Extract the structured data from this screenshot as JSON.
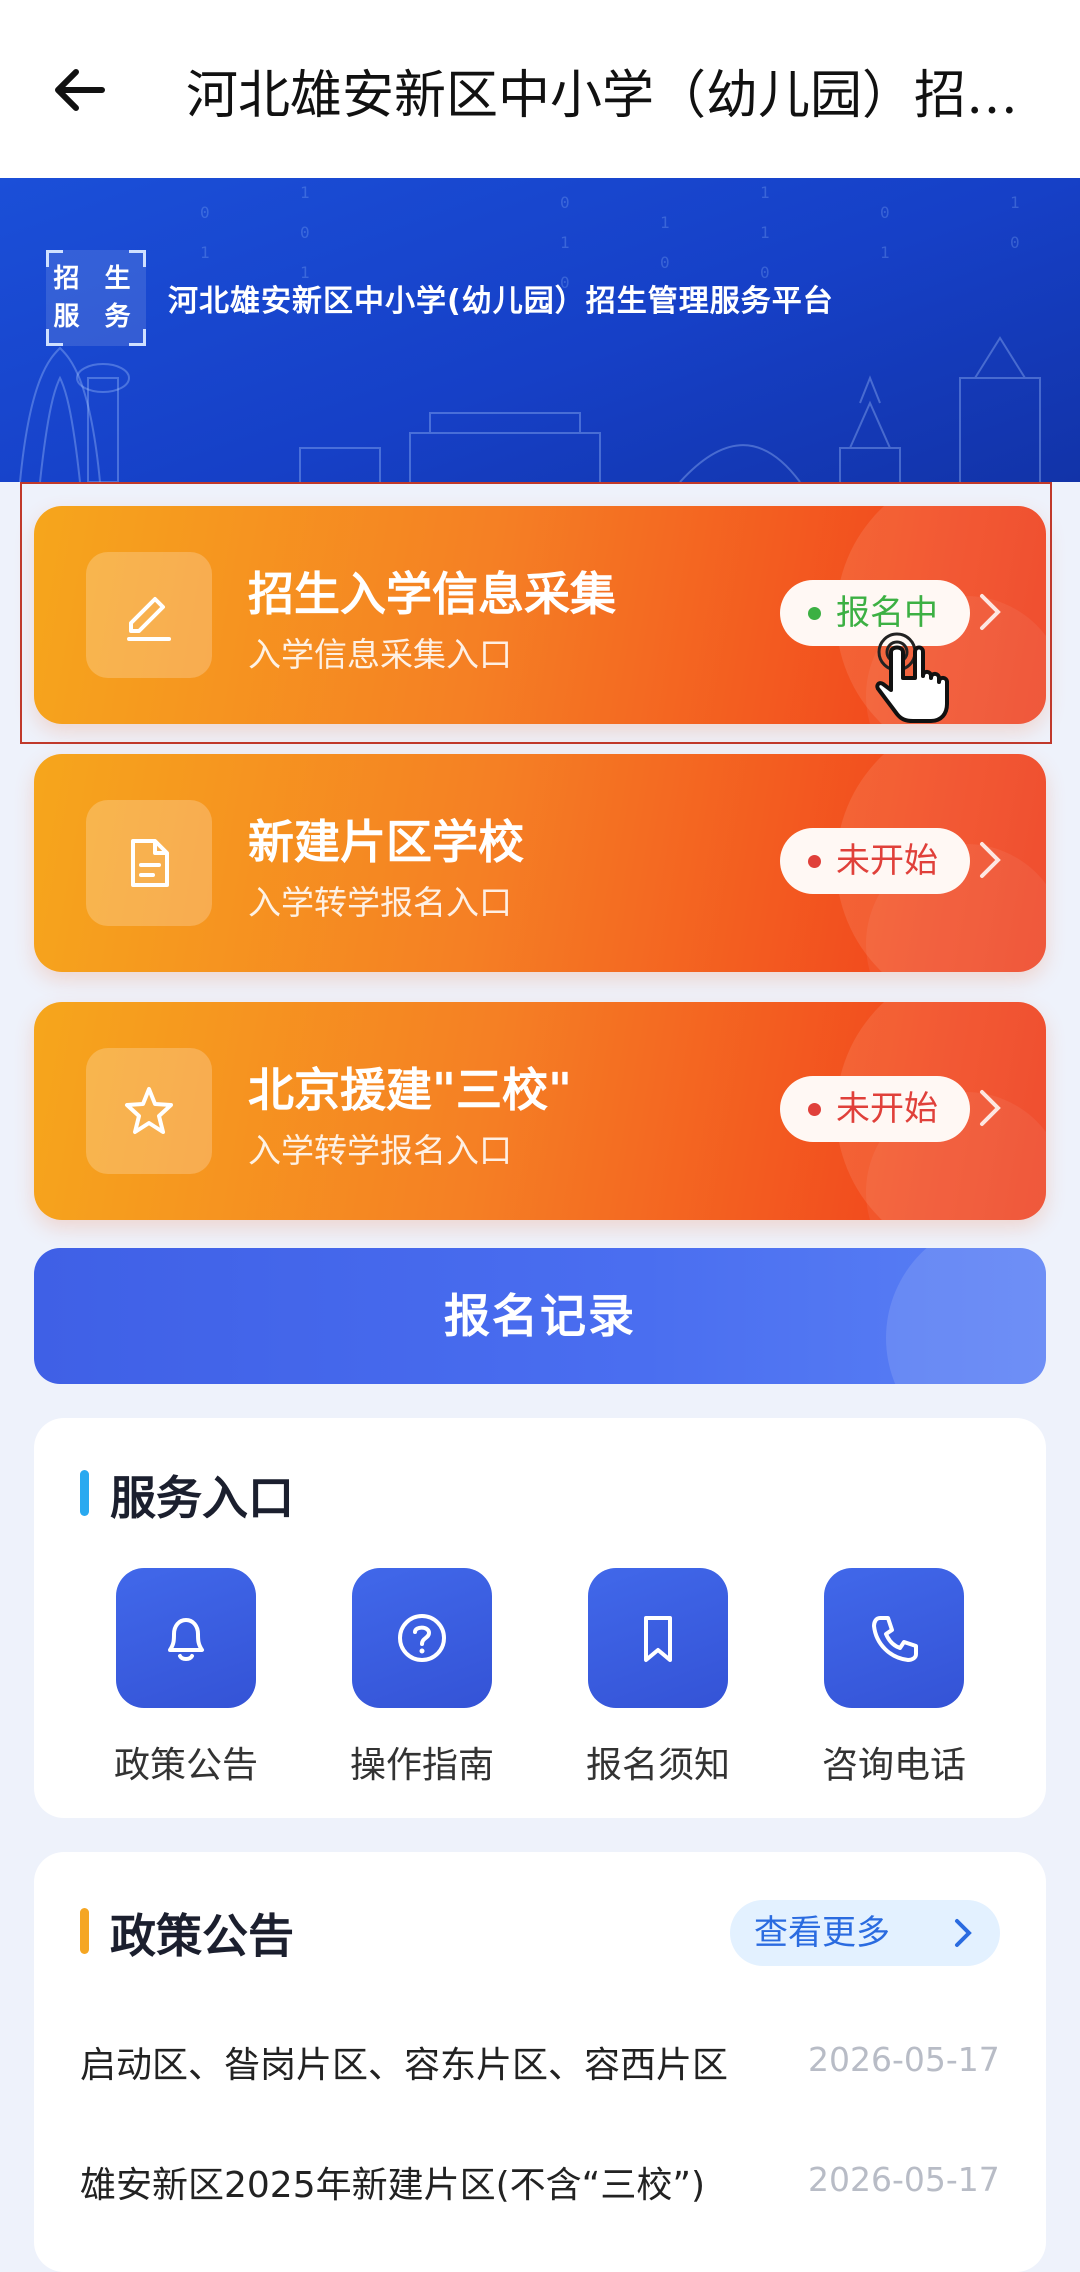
{
  "header": {
    "title": "河北雄安新区中小学（幼儿园）招生管理服务平台"
  },
  "banner": {
    "badge_line1": "招 生",
    "badge_line2": "服 务",
    "title": "河北雄安新区中小学(幼儿园）招生管理服务平台"
  },
  "cards": [
    {
      "title": "招生入学信息采集",
      "subtitle": "入学信息采集入口",
      "status": "报名中",
      "status_color": "#3cb043",
      "icon": "pencil-icon"
    },
    {
      "title": "新建片区学校",
      "subtitle": "入学转学报名入口",
      "status": "未开始",
      "status_color": "#e0403a",
      "icon": "document-icon"
    },
    {
      "title": "北京援建\"三校\"",
      "subtitle": "入学转学报名入口",
      "status": "未开始",
      "status_color": "#e0403a",
      "icon": "star-icon"
    }
  ],
  "record_button": "报名记录",
  "services": {
    "title": "服务入口",
    "accent": "#29a9f0",
    "items": [
      {
        "label": "政策公告",
        "icon": "bell-icon"
      },
      {
        "label": "操作指南",
        "icon": "question-icon"
      },
      {
        "label": "报名须知",
        "icon": "bookmark-icon"
      },
      {
        "label": "咨询电话",
        "icon": "phone-icon"
      }
    ]
  },
  "policy": {
    "title": "政策公告",
    "accent": "#f5a623",
    "more": "查看更多",
    "items": [
      {
        "title": "启动区、昝岗片区、容东片区、容西片区",
        "date": "2026-05-17"
      },
      {
        "title": "雄安新区2025年新建片区(不含“三校”)",
        "date": "2026-05-17"
      }
    ]
  }
}
